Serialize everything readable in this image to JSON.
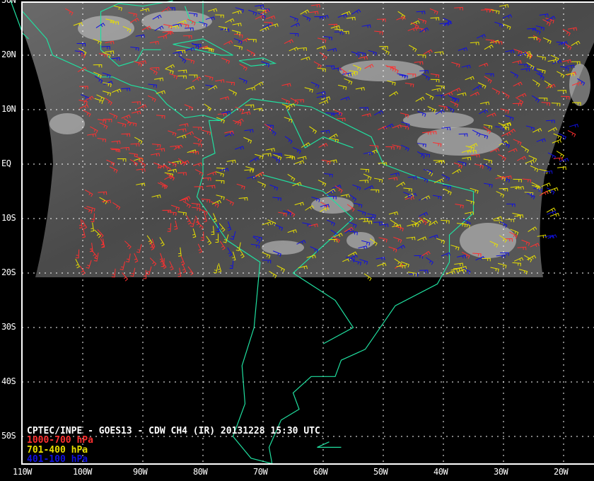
{
  "title": "CPTEC/INPE - GOES13 - CDW CH4 (IR) 20131228 15:30 UTC",
  "legend": [
    {
      "label": "1000-700 hPa",
      "color": "#ff3030"
    },
    {
      "label": "701-400 hPa",
      "color": "#e8e000"
    },
    {
      "label": "401-100 hPa",
      "color": "#1010e0"
    }
  ],
  "lon_labels": [
    "110W",
    "100W",
    "90W",
    "80W",
    "70W",
    "60W",
    "50W",
    "40W",
    "30W",
    "20W"
  ],
  "lat_labels": [
    "30N",
    "20N",
    "10N",
    "EQ",
    "10S",
    "20S",
    "30S",
    "40S",
    "50S"
  ],
  "colors": {
    "coast": "#20e0a0",
    "grid": "#ffffff",
    "background": "#000000"
  }
}
